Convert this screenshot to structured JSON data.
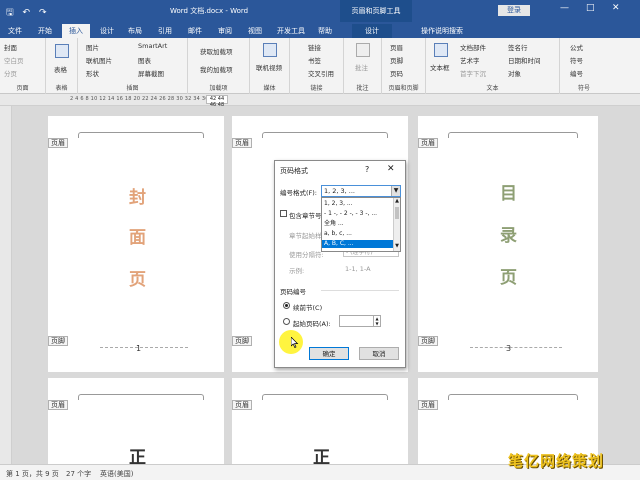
{
  "window": {
    "title": "Word 文档.docx - Word",
    "context_tab": "页眉和页脚工具",
    "login": "登录",
    "minimize": "—",
    "restore": "□",
    "close": "✕"
  },
  "quick_access": {
    "save": "🖫",
    "undo": "↶",
    "redo": "↷"
  },
  "tabs": [
    "文件",
    "开始",
    "插入",
    "设计",
    "布局",
    "引用",
    "邮件",
    "审阅",
    "视图",
    "开发工具",
    "帮助",
    "设计",
    "操作说明搜索"
  ],
  "active_tab": "插入",
  "ribbon": {
    "pages": {
      "items": [
        "封面",
        "空白页",
        "分页"
      ],
      "label": "页面"
    },
    "tables": {
      "item": "表格",
      "label": "表格"
    },
    "illustrations": {
      "col1": [
        "图片",
        "联机图片",
        "形状"
      ],
      "col2": [
        "SmartArt",
        "图表",
        "屏幕截图"
      ],
      "label": "插图"
    },
    "addins": {
      "items": [
        "获取加载项",
        "我的加载项"
      ],
      "label": "加载项"
    },
    "media": {
      "item": "联机视频",
      "label": "媒体"
    },
    "links": {
      "items": [
        "链接",
        "书签",
        "交叉引用"
      ],
      "label": "链接"
    },
    "comments": {
      "item": "批注",
      "label": "批注"
    },
    "header_footer": {
      "items": [
        "页眉",
        "页脚",
        "页码"
      ],
      "label": "页眉和页脚"
    },
    "text": {
      "big": "文本框",
      "col1": [
        "文档部件",
        "艺术字",
        "首字下沉"
      ],
      "col2": [
        "签名行",
        "日期和时间",
        "对象"
      ],
      "label": "文本"
    },
    "symbols": {
      "items": [
        "公式",
        "符号",
        "编号"
      ],
      "label": "符号"
    }
  },
  "ruler": {
    "numbers": "2  4  6  8 10 12 14 16 18 20 22 24 26 28 30 32 34 36 38 40",
    "marker": "42 44 46 48"
  },
  "document": {
    "header_tag": "页眉",
    "footer_tag": "页脚",
    "page1_text": [
      "封",
      "面",
      "页"
    ],
    "page1_color": "#e2a37a",
    "page1_number": "1",
    "page3_text": [
      "目",
      "录",
      "页"
    ],
    "page3_color": "#8e9f74",
    "page3_number": "3",
    "lower_page_text": "正"
  },
  "dialog": {
    "title": "页码格式",
    "help": "?",
    "close": "✕",
    "format_label": "编号格式(F):",
    "format_value": "1, 2, 3, ...",
    "format_options": [
      "1, 2, 3, ...",
      "- 1 -, - 2 -, - 3 -, ...",
      "全角 ...",
      "a, b, c, ...",
      "A, B, C, ..."
    ],
    "selected_option_index": 4,
    "include_chapter": "包含章节号",
    "chapter_start": "章节起始样",
    "separator": "使用分隔符:",
    "separator_value": "- (连字符)",
    "example_label": "示例:",
    "example_value": "1-1, 1-A",
    "numbering_title": "页码编号",
    "continue": "续前节(C)",
    "start_at": "起始页码(A):",
    "ok": "确定",
    "cancel": "取消"
  },
  "status": {
    "page": "第 1 页，共 9 页",
    "words": "27 个字",
    "language": "英语(美国)"
  },
  "watermark": "笔亿网络策划",
  "colors": {
    "brand": "#2b579a",
    "selection": "#0078d7",
    "highlight": "#fff000"
  }
}
